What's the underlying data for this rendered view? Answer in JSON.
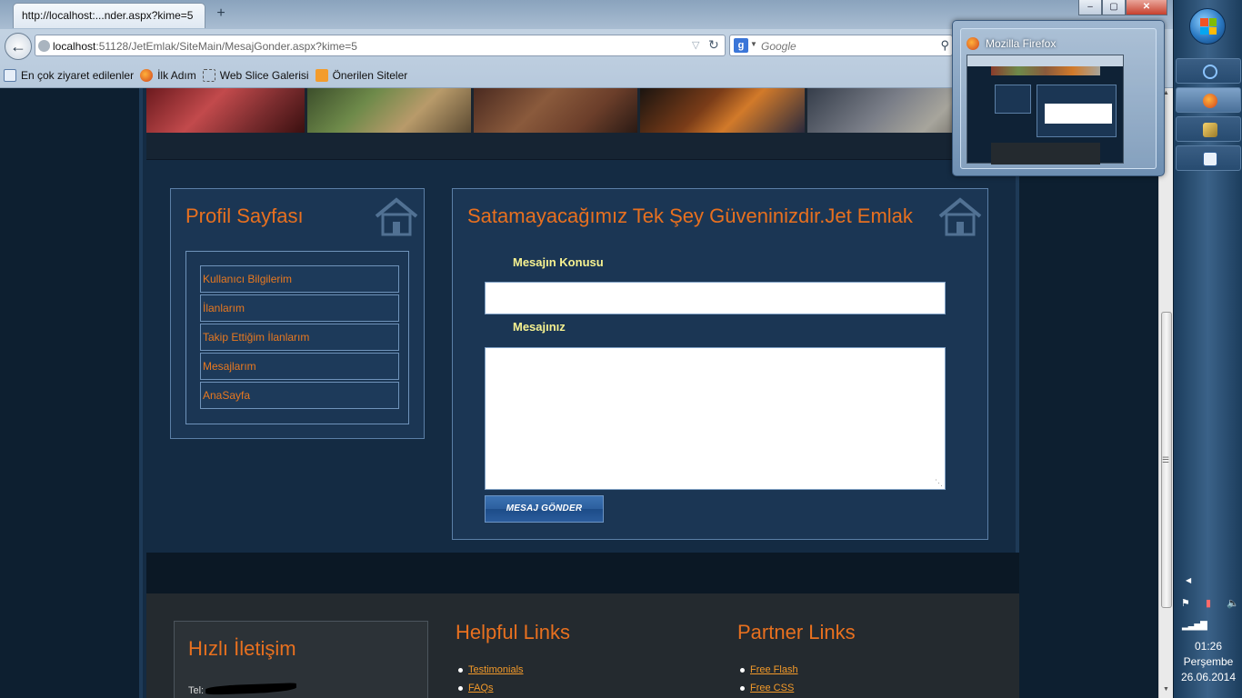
{
  "browser": {
    "tab_title": "http://localhost:...nder.aspx?kime=5",
    "new_tab_label": "+",
    "url_host": "localhost",
    "url_rest": ":51128/JetEmlak/SiteMain/MesajGonder.aspx?kime=5",
    "search_placeholder": "Google",
    "search_engine_letter": "g",
    "window_buttons": {
      "minimize": "–",
      "maximize": "▢",
      "close": "✕"
    },
    "bookmarks": [
      {
        "label": "En çok ziyaret edilenler",
        "icon": "page-icon"
      },
      {
        "label": "İlk Adım",
        "icon": "firefox-icon"
      },
      {
        "label": "Web Slice Galerisi",
        "icon": "web-slice-icon"
      },
      {
        "label": "Önerilen Siteler",
        "icon": "suggested-sites-icon"
      }
    ]
  },
  "profile_panel": {
    "title": "Profil Sayfası",
    "menu": [
      "Kullanıcı Bilgilerim",
      "İlanlarım",
      "Takip Ettiğim İlanlarım",
      "Mesajlarım",
      "AnaSayfa"
    ]
  },
  "message_panel": {
    "title": "Satamayacağımız Tek Şey Güveninizdir.Jet Emlak",
    "subject_label": "Mesajın Konusu",
    "subject_value": "",
    "message_label": "Mesajınız",
    "message_value": "",
    "send_button": "MESAJ GÖNDER"
  },
  "footer": {
    "contact_title": "Hızlı İletişim",
    "tel_label": "Tel:",
    "helpful_title": "Helpful Links",
    "helpful_links": [
      "Testimonials",
      "FAQs"
    ],
    "partner_title": "Partner Links",
    "partner_links": [
      "Free Flash",
      "Free CSS"
    ]
  },
  "taskbar": {
    "preview_title": "Mozilla Firefox",
    "time": "01:26",
    "day": "Perşembe",
    "date": "26.06.2014",
    "apps": [
      "internet-explorer-icon",
      "firefox-icon",
      "tools-icon",
      "document-icon"
    ]
  },
  "colors": {
    "accent_orange": "#e8701f",
    "label_yellow": "#f7f290",
    "panel_bg": "#1b3654",
    "page_bg": "#0d1f30"
  }
}
